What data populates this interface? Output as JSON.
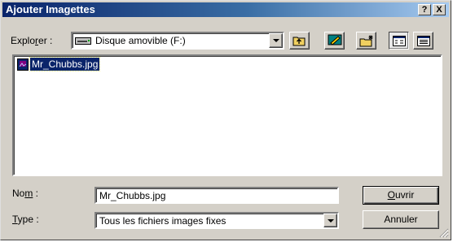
{
  "dialog": {
    "title": "Ajouter Imagettes",
    "help_label": "?",
    "close_label": "X"
  },
  "explorer": {
    "label_pre": "Explo",
    "label_u": "r",
    "label_post": "er :",
    "location": "Disque amovible (F:)"
  },
  "files": [
    {
      "name": "Mr_Chubbs.jpg",
      "selected": true
    }
  ],
  "name_field": {
    "label_pre": "No",
    "label_u": "m",
    "label_post": " :",
    "value": "Mr_Chubbs.jpg"
  },
  "type_field": {
    "label_u": "T",
    "label_post": "ype :",
    "value": "Tous les fichiers images fixes"
  },
  "buttons": {
    "open_u": "O",
    "open_rest": "uvrir",
    "cancel": "Annuler"
  },
  "colors": {
    "face": "#d4d0c8",
    "title_start": "#0a246a",
    "title_end": "#a6caf0",
    "selection": "#0a246a"
  }
}
